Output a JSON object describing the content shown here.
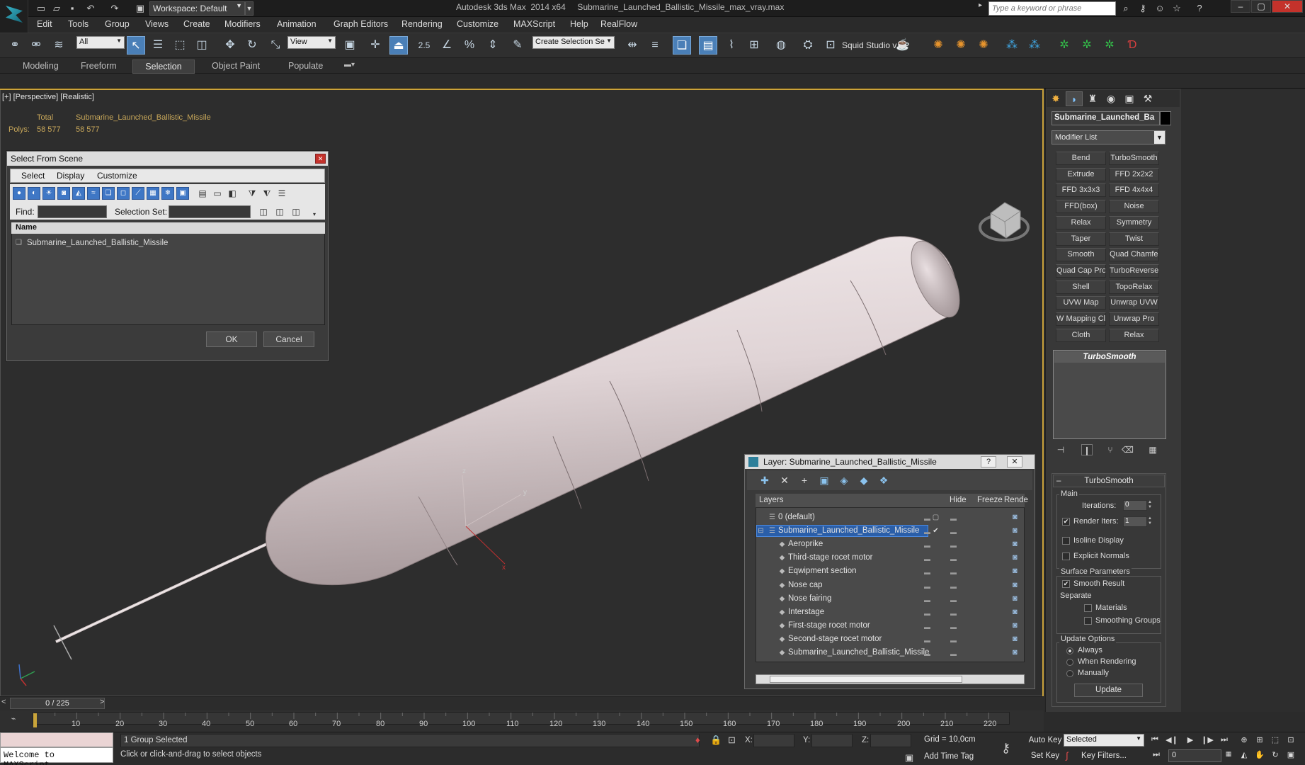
{
  "app": {
    "title": "Autodesk 3ds Max  2014 x64     Submarine_Launched_Ballistic_Missile_max_vray.max",
    "workspace": "Workspace: Default",
    "search_placeholder": "Type a keyword or phrase"
  },
  "menu": [
    "Edit",
    "Tools",
    "Group",
    "Views",
    "Create",
    "Modifiers",
    "Animation",
    "Graph Editors",
    "Rendering",
    "Customize",
    "MAXScript",
    "Help",
    "RealFlow"
  ],
  "toolbar": {
    "filter_value": "All",
    "refcoord_value": "View",
    "snap_value": "2.5",
    "selset_placeholder": "Create Selection Se",
    "squid_label": "Squid Studio v"
  },
  "ribbon_tabs": [
    "Modeling",
    "Freeform",
    "Selection",
    "Object Paint",
    "Populate"
  ],
  "viewport": {
    "label": "[+] [Perspective] [Realistic]",
    "stats": {
      "total_label": "Total",
      "object_label": "Submarine_Launched_Ballistic_Missile",
      "polys_label": "Polys:",
      "polys_total": "58 577",
      "polys_object": "58 577"
    },
    "axis_labels": {
      "z": "z",
      "y": "y",
      "x": "x"
    }
  },
  "select_from_scene": {
    "title": "Select From Scene",
    "menu": [
      "Select",
      "Display",
      "Customize"
    ],
    "find_label": "Find:",
    "selection_set_label": "Selection Set:",
    "column_name": "Name",
    "items": [
      "Submarine_Launched_Ballistic_Missile"
    ],
    "ok": "OK",
    "cancel": "Cancel"
  },
  "layer_dialog": {
    "title": "Layer: Submarine_Launched_Ballistic_Missile",
    "columns": {
      "layers": "Layers",
      "hide": "Hide",
      "freeze": "Freeze",
      "render": "Rende"
    },
    "rows": [
      {
        "name": "0 (default)",
        "level": 0
      },
      {
        "name": "Submarine_Launched_Ballistic_Missile",
        "level": 0,
        "selected": true
      },
      {
        "name": "Aeroprike",
        "level": 1
      },
      {
        "name": "Third-stage rocet motor",
        "level": 1
      },
      {
        "name": "Eqwipment section",
        "level": 1
      },
      {
        "name": "Nose cap",
        "level": 1
      },
      {
        "name": "Nose fairing",
        "level": 1
      },
      {
        "name": "Interstage",
        "level": 1
      },
      {
        "name": "First-stage rocet motor",
        "level": 1
      },
      {
        "name": "Second-stage rocet motor",
        "level": 1
      },
      {
        "name": "Submarine_Launched_Ballistic_Missile",
        "level": 1
      }
    ]
  },
  "command_panel": {
    "object_name": "Submarine_Launched_Ba",
    "modifier_list": "Modifier List",
    "modifier_buttons": [
      "Bend",
      "TurboSmooth",
      "Extrude",
      "FFD 2x2x2",
      "FFD 3x3x3",
      "FFD 4x4x4",
      "FFD(box)",
      "Noise",
      "Relax",
      "Symmetry",
      "Taper",
      "Twist",
      "Smooth",
      "Quad Chamfer",
      "Quad Cap Pro",
      "TurboReverse",
      "Shell",
      "TopoRelax",
      "UVW Map",
      "Unwrap UVW",
      "W Mapping Cle",
      "Unwrap Pro",
      "Cloth",
      "Relax"
    ],
    "stack_item": "TurboSmooth",
    "turbosmooth": {
      "header": "TurboSmooth",
      "main_label": "Main",
      "iterations_label": "Iterations:",
      "iterations_value": "0",
      "render_iters_label": "Render Iters:",
      "render_iters_value": "1",
      "render_iters_checked": true,
      "isoline_label": "Isoline Display",
      "explicit_normals_label": "Explicit Normals",
      "surface_params_label": "Surface Parameters",
      "smooth_result_label": "Smooth Result",
      "separate_label": "Separate",
      "materials_label": "Materials",
      "smoothing_groups_label": "Smoothing Groups",
      "update_options_label": "Update Options",
      "always_label": "Always",
      "when_rendering_label": "When Rendering",
      "manually_label": "Manually",
      "update_button": "Update"
    }
  },
  "timeline": {
    "readout": "0 / 225",
    "ticks": [
      "10",
      "20",
      "30",
      "40",
      "50",
      "60",
      "70",
      "80",
      "90",
      "100",
      "110",
      "120",
      "130",
      "140",
      "150",
      "160",
      "170",
      "180",
      "190",
      "200",
      "210",
      "220"
    ]
  },
  "status": {
    "maxscript_output": "Welcome to MAXScript.",
    "selection_status": "1 Group Selected",
    "prompt": "Click or click-and-drag to select objects",
    "x_label": "X:",
    "y_label": "Y:",
    "z_label": "Z:",
    "grid": "Grid = 10,0cm",
    "add_time_tag": "Add Time Tag",
    "auto_key": "Auto Key",
    "set_key": "Set Key",
    "key_mode_value": "Selected",
    "key_filters": "Key Filters...",
    "frame_value": "0"
  },
  "colors": {
    "viewport_border": "#cba33b",
    "selection_highlight": "#2a5ea8",
    "stats_text": "#c9a85a"
  }
}
